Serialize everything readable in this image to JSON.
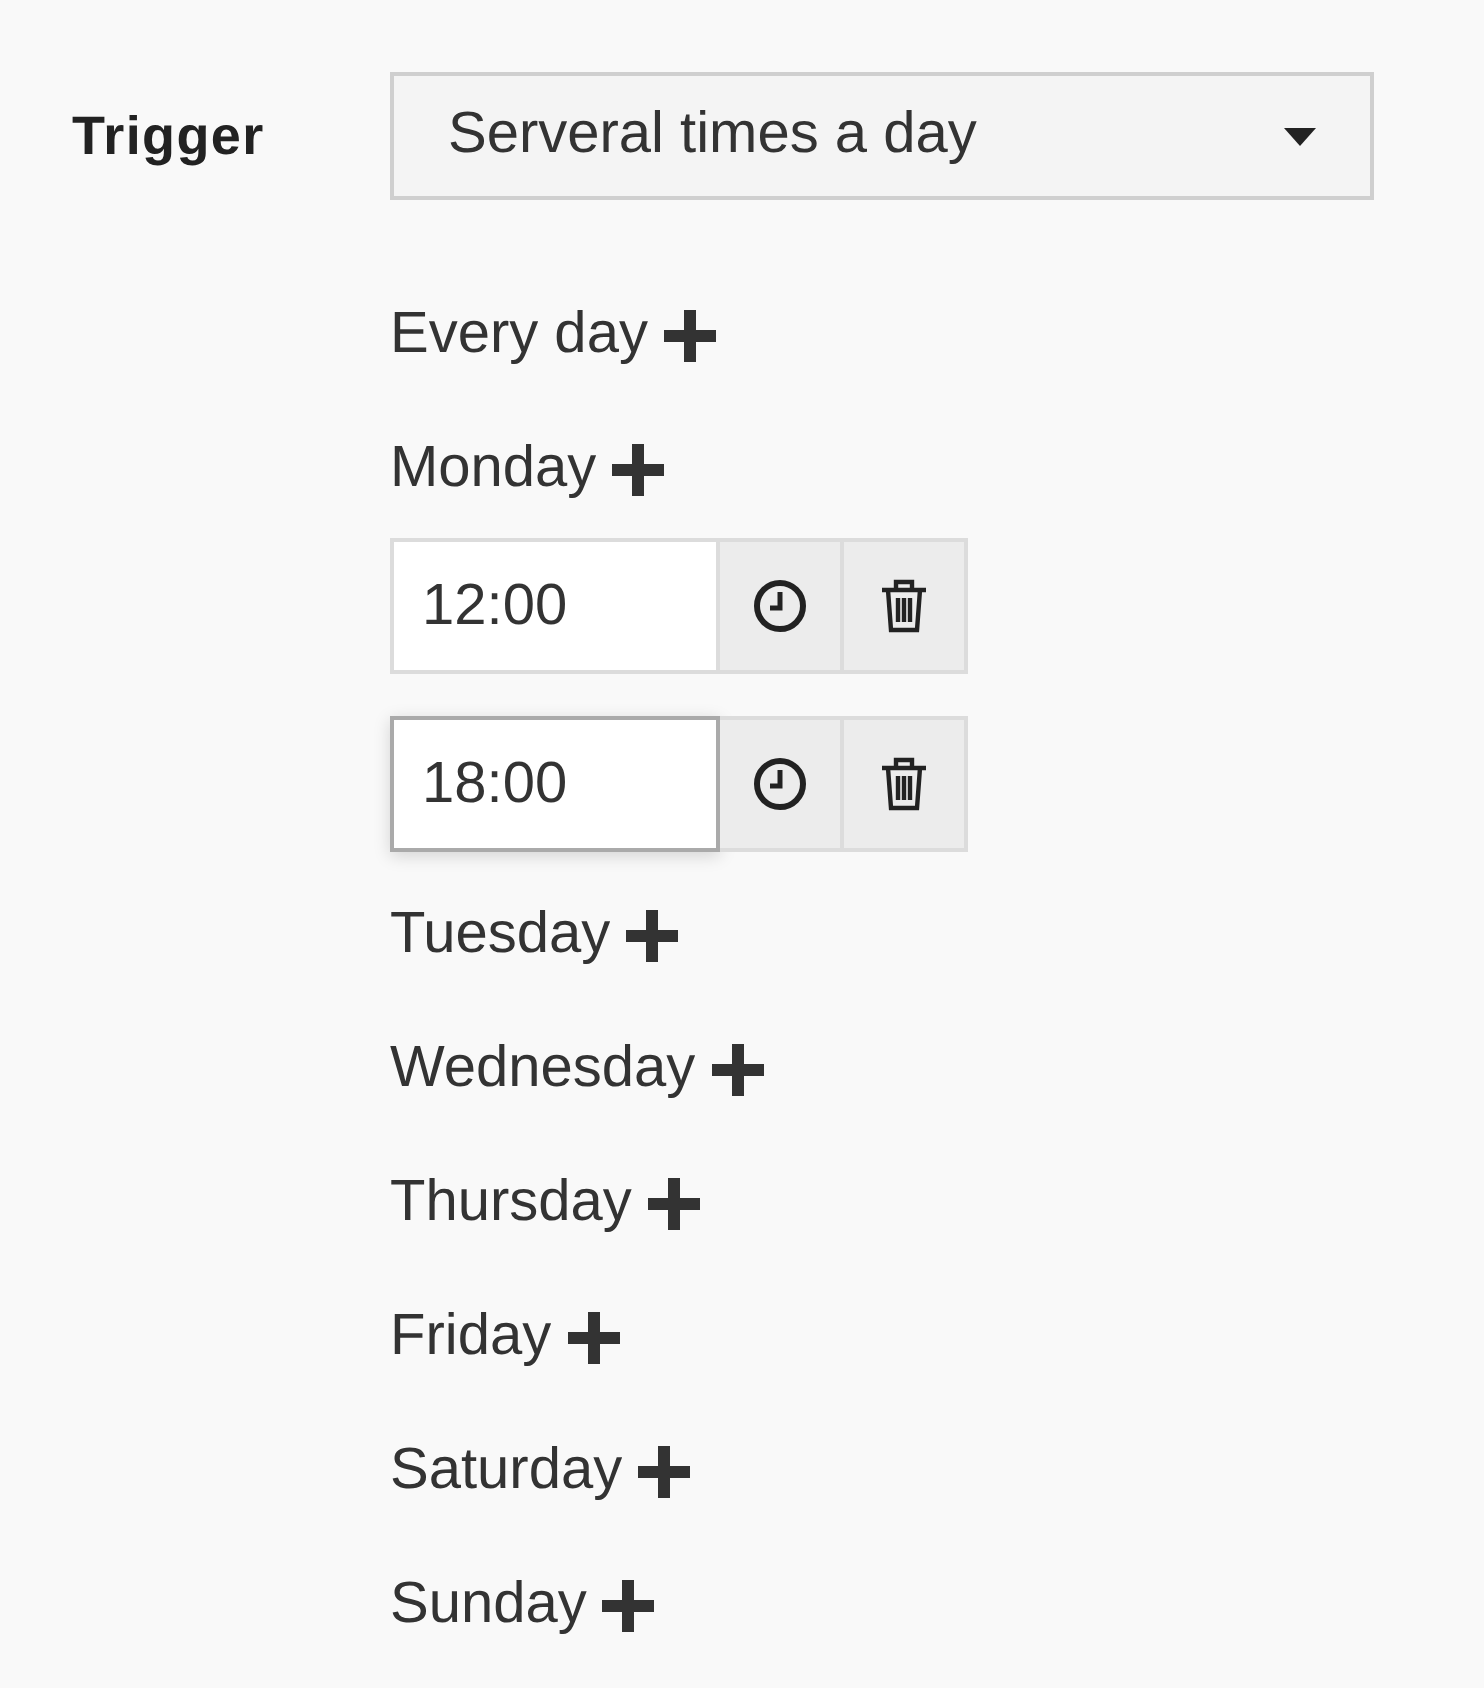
{
  "trigger": {
    "label": "Trigger",
    "value": "Serveral times a day"
  },
  "days": [
    {
      "label": "Every day"
    },
    {
      "label": "Monday",
      "times": [
        {
          "value": "12:00",
          "focused": false
        },
        {
          "value": "18:00",
          "focused": true
        }
      ]
    },
    {
      "label": "Tuesday"
    },
    {
      "label": "Wednesday"
    },
    {
      "label": "Thursday"
    },
    {
      "label": "Friday"
    },
    {
      "label": "Saturday"
    },
    {
      "label": "Sunday"
    }
  ]
}
